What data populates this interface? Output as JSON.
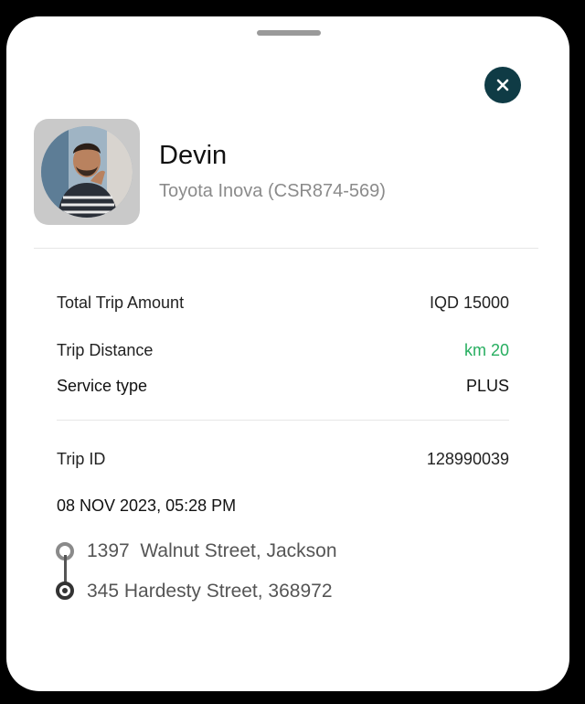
{
  "driver": {
    "name": "Devin",
    "vehicle": "Toyota Inova (CSR874-569)"
  },
  "trip": {
    "total_label": "Total Trip Amount",
    "total_value": "IQD 15000",
    "distance_label": "Trip Distance",
    "distance_value": "km 20",
    "service_label": "Service type",
    "service_value": "PLUS",
    "id_label": "Trip ID",
    "id_value": "128990039",
    "datetime": "08 NOV 2023, 05:28 PM"
  },
  "route": {
    "pickup": "1397  Walnut Street, Jackson",
    "dropoff": "345 Hardesty Street, 368972"
  },
  "colors": {
    "close_button": "#0f3b45",
    "distance_accent": "#27ae60"
  },
  "icons": {
    "close": "close-icon",
    "pickup": "pickup-pin-icon",
    "dropoff": "dropoff-pin-icon"
  }
}
